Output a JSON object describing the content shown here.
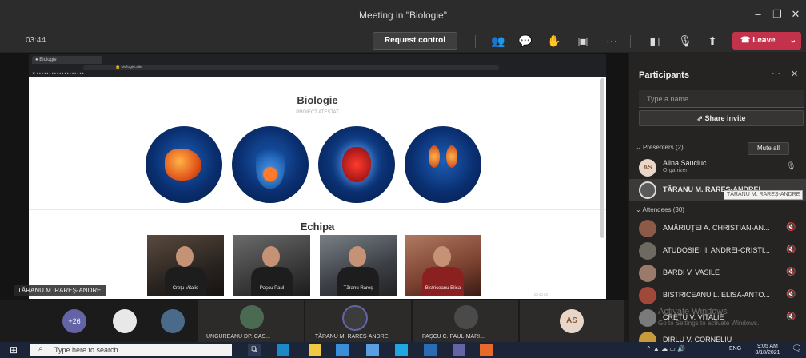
{
  "window": {
    "title": "Meeting in \"Biologie\""
  },
  "toolbar": {
    "timer": "03:44",
    "request_control": "Request control",
    "more": "···",
    "leave": "Leave"
  },
  "shared_screen": {
    "site_title": "Biologie",
    "site_subtitle": "PROIECT ATESTAT",
    "team_title": "Echipa",
    "members": [
      {
        "name": "Crețu Vitalie"
      },
      {
        "name": "Pașcu Paul"
      },
      {
        "name": "Țăranu Rareș"
      },
      {
        "name": "Bistriceanu Elisa"
      }
    ]
  },
  "presenter_label": "TĂRANU M. RAREȘ-ANDREI",
  "panel": {
    "title": "Participants",
    "search_placeholder": "Type a name",
    "share_invite": "Share invite",
    "presenters_header": "Presenters (2)",
    "mute_all": "Mute all",
    "presenters": [
      {
        "name": "Alina Sauciuc",
        "role": "Organizer",
        "initials": "AS"
      },
      {
        "name": "TĂRANU M. RAREȘ-ANDREI",
        "role": ""
      }
    ],
    "tooltip": "TĂRANU M. RAREȘ-ANDRE",
    "attendees_header": "Attendees (30)",
    "attendees": [
      {
        "name": "AMĂRIUȚEI A. CHRISTIAN-AN..."
      },
      {
        "name": "ATUDOSIEI II. ANDREI-CRISTI..."
      },
      {
        "name": "BARDI V. VASILE"
      },
      {
        "name": "BISTRICEANU L. ELISA-ANTO..."
      },
      {
        "name": "CRETU V. VITALIE"
      },
      {
        "name": "DIRLU V. CORNELIU"
      }
    ],
    "watermark_1": "Activate Windows",
    "watermark_2": "Go to Settings to activate Windows."
  },
  "strip": {
    "more_count": "+26",
    "tiles": [
      {
        "name": "UNGUREANU DP. CAS..."
      },
      {
        "name": "TĂRANU M. RAREȘ-ANDREI"
      },
      {
        "name": "PAȘCU C. PAUL-MARI..."
      }
    ],
    "initials_tile": "AS"
  },
  "taskbar": {
    "search_placeholder": "Type here to search",
    "language": "ENG",
    "time": "9:05 AM",
    "date": "3/18/2021"
  },
  "colors": {
    "leave": "#c4314b",
    "accent": "#6264a7"
  }
}
